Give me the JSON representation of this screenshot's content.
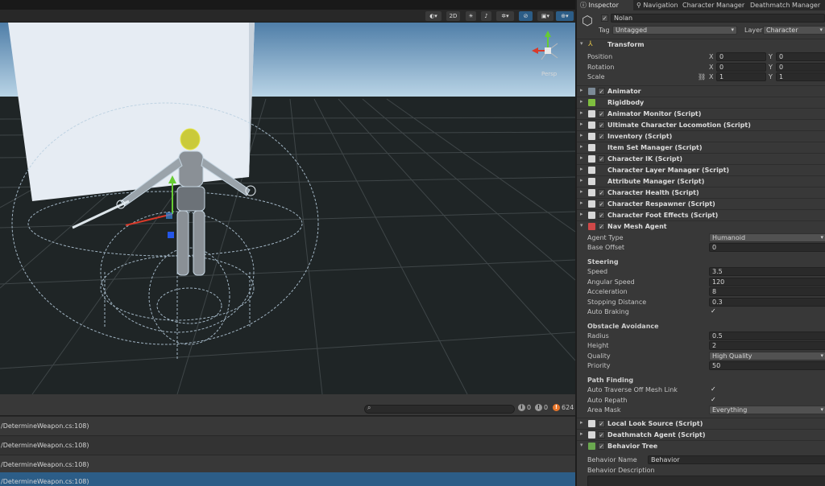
{
  "scene": {
    "toolbar": {
      "shading_icon": "circle-shading-icon",
      "mode_2d_label": "2D",
      "lighting_icon": "lightbulb-icon",
      "audio_icon": "speaker-icon",
      "effects_icon": "effects-icon",
      "visibility_icon": "eye-slash-icon",
      "camera_icon": "camera-icon",
      "gizmos_icon": "globe-gizmo-icon"
    },
    "gizmo": {
      "persp_label": "Persp"
    }
  },
  "console": {
    "search_placeholder": "",
    "counts": {
      "info": "0",
      "warning": "0",
      "error": "624"
    },
    "rows": [
      "/DetermineWeapon.cs:108)",
      "/DetermineWeapon.cs:108)",
      "/DetermineWeapon.cs:108)",
      "/DetermineWeapon.cs:108)"
    ]
  },
  "inspector": {
    "tabs": [
      "Inspector",
      "Navigation",
      "Character Manager",
      "Deathmatch Manager"
    ],
    "object": {
      "name": "Nolan",
      "tag_label": "Tag",
      "tag_value": "Untagged",
      "layer_label": "Layer",
      "layer_value": "Character"
    },
    "transform": {
      "title": "Transform",
      "position_label": "Position",
      "position": {
        "x": "0",
        "y": "0"
      },
      "rotation_label": "Rotation",
      "rotation": {
        "x": "0",
        "y": "0"
      },
      "scale_label": "Scale",
      "scale": {
        "x": "1",
        "y": "1"
      },
      "x_label": "X",
      "y_label": "Y"
    },
    "components": [
      {
        "name": "Animator",
        "checked": true
      },
      {
        "name": "Rigidbody",
        "checked": false
      },
      {
        "name": "Animator Monitor (Script)",
        "checked": true
      },
      {
        "name": "Ultimate Character Locomotion (Script)",
        "checked": true
      },
      {
        "name": "Inventory (Script)",
        "checked": true
      },
      {
        "name": "Item Set Manager (Script)",
        "checked": false
      },
      {
        "name": "Character IK (Script)",
        "checked": true
      },
      {
        "name": "Character Layer Manager (Script)",
        "checked": false
      },
      {
        "name": "Attribute Manager (Script)",
        "checked": false
      },
      {
        "name": "Character Health (Script)",
        "checked": true
      },
      {
        "name": "Character Respawner (Script)",
        "checked": true
      },
      {
        "name": "Character Foot Effects (Script)",
        "checked": true
      },
      {
        "name": "Nav Mesh Agent",
        "checked": true
      }
    ],
    "nav_mesh_agent": {
      "agent_type_label": "Agent Type",
      "agent_type": "Humanoid",
      "base_offset_label": "Base Offset",
      "base_offset": "0",
      "steering_header": "Steering",
      "speed_label": "Speed",
      "speed": "3.5",
      "angular_speed_label": "Angular Speed",
      "angular_speed": "120",
      "acceleration_label": "Acceleration",
      "acceleration": "8",
      "stopping_distance_label": "Stopping Distance",
      "stopping_distance": "0.3",
      "auto_braking_label": "Auto Braking",
      "auto_braking": true,
      "obstacle_header": "Obstacle Avoidance",
      "radius_label": "Radius",
      "radius": "0.5",
      "height_label": "Height",
      "height": "2",
      "quality_label": "Quality",
      "quality": "High Quality",
      "priority_label": "Priority",
      "priority": "50",
      "pathfinding_header": "Path Finding",
      "auto_traverse_label": "Auto Traverse Off Mesh Link",
      "auto_traverse": true,
      "auto_repath_label": "Auto Repath",
      "auto_repath": true,
      "area_mask_label": "Area Mask",
      "area_mask": "Everything"
    },
    "more_components": [
      {
        "name": "Local Look Source (Script)",
        "checked": true
      },
      {
        "name": "Deathmatch Agent (Script)",
        "checked": true
      },
      {
        "name": "Behavior Tree",
        "checked": true
      }
    ],
    "behavior_tree": {
      "behavior_name_label": "Behavior Name",
      "behavior_name": "Behavior",
      "behavior_description_label": "Behavior Description"
    }
  },
  "colors": {
    "accent_blue": "#2c5d87",
    "error_orange": "#e8752a",
    "sky_top": "#4f7ea8",
    "ground": "#1f2526"
  }
}
